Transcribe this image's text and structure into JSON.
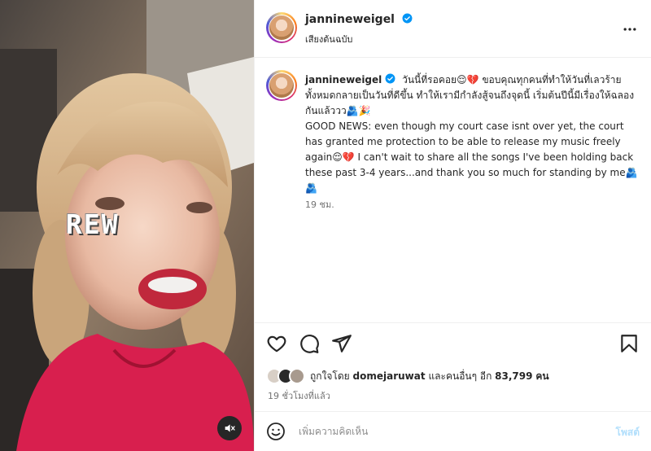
{
  "media": {
    "overlay_text": "REW",
    "mute_icon": "speaker-muted-icon"
  },
  "header": {
    "username": "jannineweigel",
    "subtitle": "เสียงต้นฉบับ",
    "verified_icon": "verified-badge-icon",
    "more_icon": "more-options-icon"
  },
  "caption": {
    "username": "jannineweigel",
    "paragraph1": "วันนี้ที่รอคอย😌💔 ขอบคุณทุกคนที่ทำให้วันที่เลวร้ายทั้งหมดกลายเป็นวันที่ดีขึ้น ทำให้เรามีกำลังสู้จนถึงจุดนี้ เริ่มต้นปีนี้มีเรื่องให้ฉลองกันแล้ววว🫂🎉",
    "paragraph2": "GOOD NEWS: even though my court case isnt over yet, the court has granted me protection to be able to release my music freely again😌💔 I can't wait to share all the songs I've been holding back these past 3-4 years...and thank you so much for standing by me🫂🫂",
    "time": "19 ชม."
  },
  "likes": {
    "prefix": "ถูกใจโดย",
    "user": "domejaruwat",
    "middle": "และคนอื่นๆ อีก",
    "count": "83,799",
    "suffix": "คน"
  },
  "posted_time": "19 ชั่วโมงที่แล้ว",
  "comment": {
    "placeholder": "เพิ่มความคิดเห็น",
    "post_label": "โพสต์"
  },
  "colors": {
    "verified": "#0095f6",
    "post_disabled": "#b2dffc",
    "muted_text": "#737373"
  }
}
